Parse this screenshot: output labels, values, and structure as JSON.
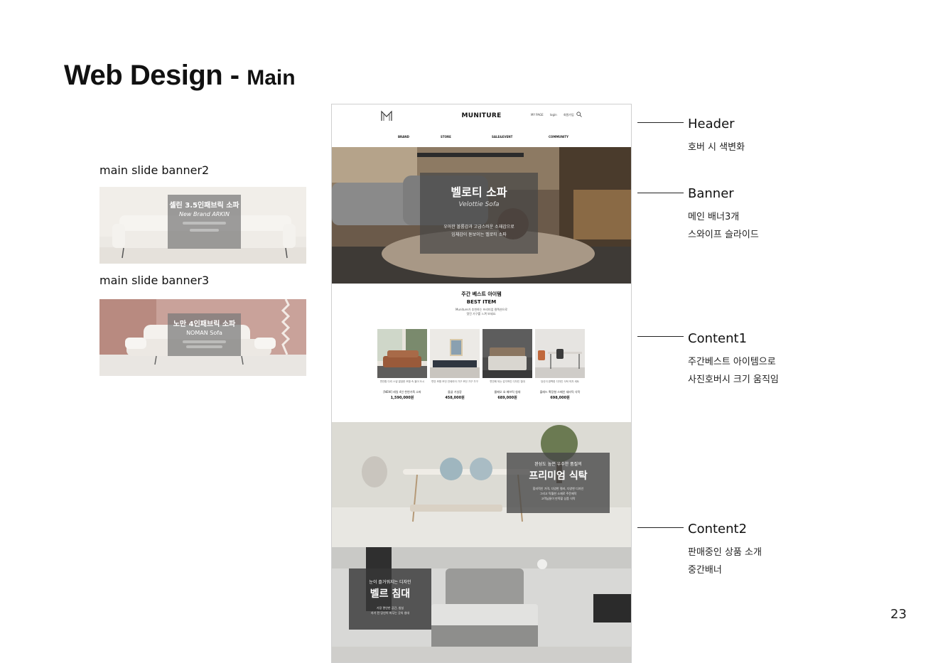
{
  "title": {
    "main": "Web Design - ",
    "sub": "Main"
  },
  "side_banners": [
    {
      "label": "main slide banner2",
      "title": "셀린 3.5인패브릭 소파",
      "subtitle": "New Brand ARKIN",
      "text": "창성에 소재되는 기편롭은 일체의\n벨로 소파"
    },
    {
      "label": "main slide banner3",
      "title": "노만 4인패브릭 소파",
      "subtitle": "NOMAN Sofa",
      "text": "명품브랜드가 추구하는 디앙인과 모양\n우아하게 곡선을 그리는\n포근하고 편안한 소파"
    }
  ],
  "mockup": {
    "brand": "MUNITURE",
    "util_links": [
      "MY PAGE",
      "login",
      "회원가입"
    ],
    "nav": [
      "BRAND",
      "STORE",
      "SALE&EVENT",
      "COMMUNITY"
    ],
    "banner": {
      "title": "벨로티 소파",
      "subtitle": "Velottie Sofa",
      "text": "우아한 볼륨감과 고급스러운 소재감으로\n입체감이 돋보이는 벨로티 소파"
    },
    "best": {
      "title_ko": "주간 베스트 아이템",
      "title_en": "BEST ITEM",
      "desc": "Muniture가 추천하는 프리미엄 컬렉션으로\n멋진 가구를 느껴 보세요."
    },
    "items": [
      {
        "desc": "편안함 다리 스냅\n깔끔한 조합 속 올어 도시",
        "name": "[NEW] 레일 4인 천연가죽 소파",
        "price": "1,590,000원"
      },
      {
        "desc": "편안 조합 모던 인테리어 가구\n모던 가구 가구",
        "name": "몰굴 거실장",
        "price": "458,000원"
      },
      {
        "desc": "편안해 되는 감각적인 디자인\n침대",
        "name": "룸메오 호 패브릭 침대",
        "price": "689,000원"
      },
      {
        "desc": "당신이 완벽한 디자인\n식탁 의자 세트",
        "name": "블레드 확장형 스페인 세라믹 식탁",
        "price": "698,000원"
      }
    ],
    "content2": {
      "subtitle": "완성도 높은 우수한 품질의",
      "title": "프리미엄 식탁",
      "text": "합리적인 가격, 다양한 컬러, 다양한 디자인\n그리고 탁월한 소재로 주문제작\n고객님들이 만족할 상품 식탁"
    },
    "content3": {
      "subtitle": "눈이 즐거워지는 디자인",
      "title": "벨르 침대",
      "text": "가장 편안한 공간, 침실\n자기 전 당신이 머무는 곳의 침대"
    }
  },
  "annotations": [
    {
      "title": "Header",
      "lines": [
        "호버 시 색변화"
      ]
    },
    {
      "title": "Banner",
      "lines": [
        "메인 배너3개",
        "스와이프 슬라이드"
      ]
    },
    {
      "title": "Content1",
      "lines": [
        "주간베스트 아이템으로",
        "사진호버시 크기 움직임"
      ]
    },
    {
      "title": "Content2",
      "lines": [
        "판매중인 상품 소개",
        "중간배너"
      ]
    }
  ],
  "page_number": "23",
  "colors": {
    "banner3_bg": "#c9a29a",
    "banner2_bg": "#ece9e4",
    "line": "#222222"
  }
}
